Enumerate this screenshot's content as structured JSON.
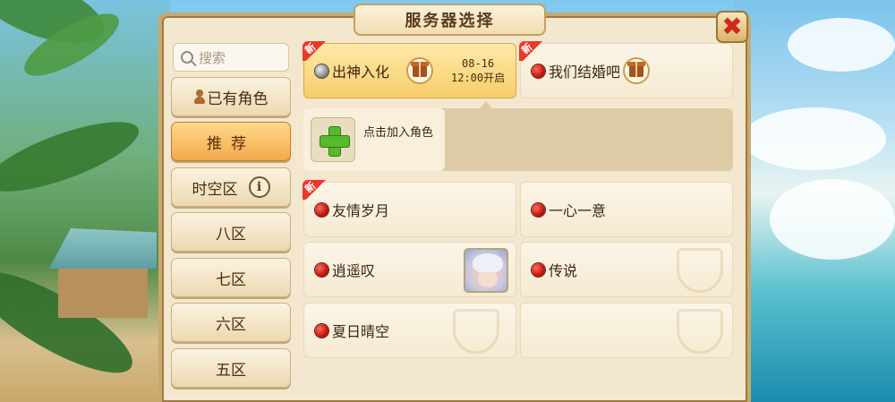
{
  "title": "服务器选择",
  "close_glyph": "✖",
  "search": {
    "placeholder": "搜索"
  },
  "sidebar": {
    "items": [
      {
        "label": "已有角色",
        "icon": "person-icon"
      },
      {
        "label": "推荐",
        "active": true
      },
      {
        "label": "时空区",
        "icon": "info-icon",
        "icon_glyph": "i"
      },
      {
        "label": "八区"
      },
      {
        "label": "七区"
      },
      {
        "label": "六区"
      },
      {
        "label": "五区"
      }
    ]
  },
  "servers": {
    "featured": [
      {
        "name": "出神入化",
        "status": "grey",
        "new_tag": "新",
        "gift": true,
        "open_date": "08-16",
        "open_time": "12:00开启"
      },
      {
        "name": "我们结婚吧",
        "status": "red",
        "new_tag": "新",
        "gift": true
      }
    ],
    "add_role": {
      "label": "点击加入角色"
    },
    "list": [
      {
        "name": "友情岁月",
        "status": "red",
        "new_tag": "新"
      },
      {
        "name": "一心一意",
        "status": "red"
      },
      {
        "name": "逍遥叹",
        "status": "red",
        "has_avatar": true
      },
      {
        "name": "传说",
        "status": "red"
      },
      {
        "name": "夏日晴空",
        "status": "red"
      }
    ]
  },
  "colors": {
    "panel": "#f3e7cf",
    "accent": "#f3a94b",
    "status_red": "#c4140d",
    "status_grey": "#8d8d8d",
    "new_tag": "#e83a2b"
  }
}
